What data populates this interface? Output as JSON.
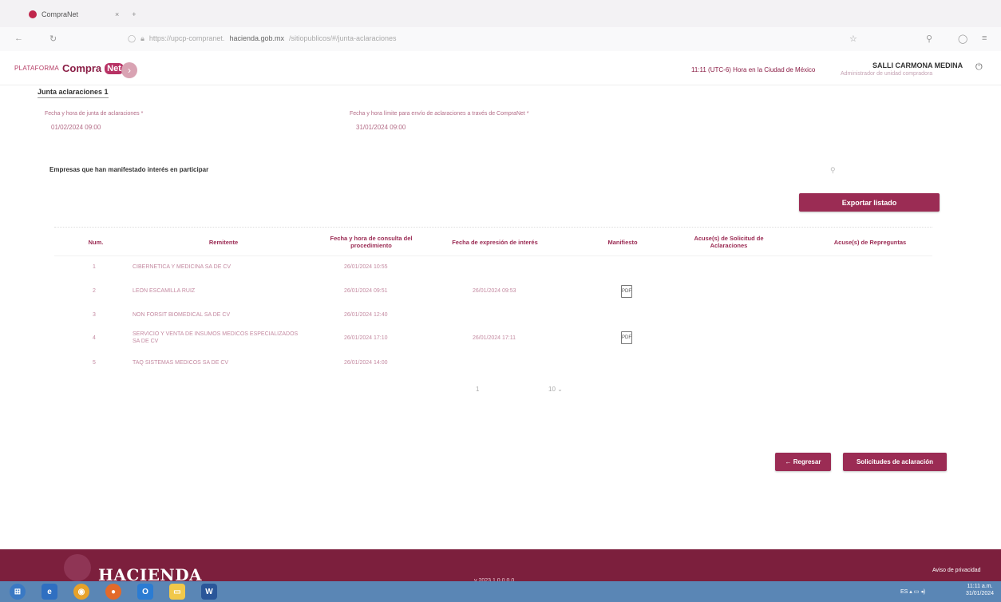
{
  "browser": {
    "tab_title": "CompraNet",
    "url_host": "hacienda.gob.mx"
  },
  "header": {
    "logo_prefix": "PLATAFORMA",
    "logo_main": "Compra",
    "logo_net": "Net",
    "clock": "11:11 (UTC-6) Hora en la Ciudad de México",
    "user_name": "SALLI CARMONA MEDINA",
    "user_role": "Administrador de unidad compradora"
  },
  "junta": {
    "title": "Junta aclaraciones 1",
    "fecha_junta_label": "Fecha y hora de junta de aclaraciones *",
    "fecha_junta_value": "01/02/2024 09:00",
    "fecha_limite_label": "Fecha y hora límite para envío de aclaraciones a través de CompraNet *",
    "fecha_limite_value": "31/01/2024 09:00"
  },
  "empresas": {
    "title": "Empresas que han manifestado interés en participar",
    "export_label": "Exportar listado"
  },
  "table": {
    "headers": {
      "num": "Num.",
      "remitente": "Remitente",
      "fecha_consulta": "Fecha y hora de consulta del procedimiento",
      "fecha_expresion": "Fecha de expresión de interés",
      "manifiesto": "Manifiesto",
      "acuse_solicitud": "Acuse(s) de Solicitud de Aclaraciones",
      "acuse_repreguntas": "Acuse(s) de Repreguntas"
    },
    "rows": [
      {
        "num": "1",
        "remitente": "CIBERNETICA Y MEDICINA SA DE CV",
        "fecha_consulta": "26/01/2024 10:55",
        "fecha_expresion": "",
        "manifiesto": false
      },
      {
        "num": "2",
        "remitente": "LEON ESCAMILLA RUIZ",
        "fecha_consulta": "26/01/2024 09:51",
        "fecha_expresion": "26/01/2024 09:53",
        "manifiesto": true
      },
      {
        "num": "3",
        "remitente": "NON FORSIT BIOMEDICAL SA DE CV",
        "fecha_consulta": "26/01/2024 12:40",
        "fecha_expresion": "",
        "manifiesto": false
      },
      {
        "num": "4",
        "remitente": "SERVICIO Y VENTA DE INSUMOS MEDICOS ESPECIALIZADOS SA DE CV",
        "fecha_consulta": "26/01/2024 17:10",
        "fecha_expresion": "26/01/2024 17:11",
        "manifiesto": true
      },
      {
        "num": "5",
        "remitente": "TAQ SISTEMAS MEDICOS SA DE CV",
        "fecha_consulta": "26/01/2024 14:00",
        "fecha_expresion": "",
        "manifiesto": false
      }
    ]
  },
  "pagination": {
    "page": "1",
    "page_size": "10"
  },
  "actions": {
    "back_label": "← Regresar",
    "solicitudes_label": "Solicitudes de aclaración"
  },
  "footer": {
    "brand": "HACIENDA",
    "version": "v 2023.1.0.0.0.0",
    "privacy": "Aviso de privacidad"
  },
  "taskbar": {
    "lang": "ES",
    "time": "11:11 a.m.",
    "date": "31/01/2024"
  },
  "colors": {
    "primary": "#9b2c54",
    "footer": "#7c1f3d",
    "taskbar": "#5a86b5"
  }
}
